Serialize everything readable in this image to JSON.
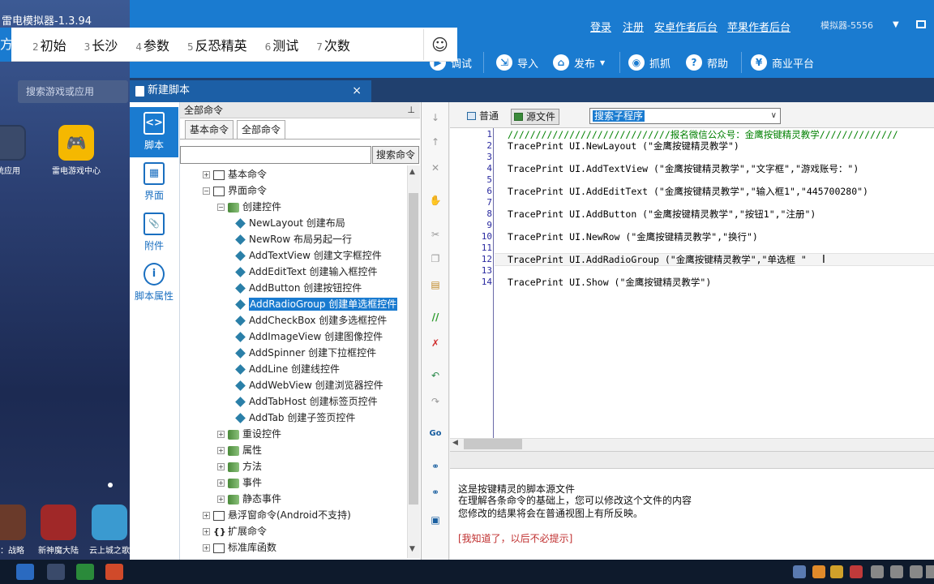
{
  "emulator": {
    "title": "雷电模拟器-1.3.94",
    "search_placeholder": "搜索游戏或应用",
    "apps": [
      {
        "label": "统应用",
        "icon": "system-apps-icon",
        "color": "#3a4a6a"
      },
      {
        "label": "雷电游戏中心",
        "icon": "game-center-icon",
        "color": "#f5b800"
      },
      {
        "label": "忠：战略",
        "icon": "game-icon",
        "color": "#6a3a2a"
      },
      {
        "label": "新神魔大陆",
        "icon": "game-icon",
        "color": "#a02828"
      },
      {
        "label": "云上城之歌",
        "icon": "game-icon",
        "color": "#3a9ad0"
      }
    ]
  },
  "overlay_tabs": {
    "first_partial": "方",
    "items": [
      {
        "num": "2",
        "label": "初始"
      },
      {
        "num": "3",
        "label": "长沙"
      },
      {
        "num": "4",
        "label": "参数"
      },
      {
        "num": "5",
        "label": "反恐精英"
      },
      {
        "num": "6",
        "label": "测试"
      },
      {
        "num": "7",
        "label": "次数"
      }
    ],
    "emoji": "☺"
  },
  "topbar": {
    "links": [
      "登录",
      "注册",
      "安卓作者后台",
      "苹果作者后台"
    ],
    "emulator_label": "模拟器-5556",
    "toolbar": [
      {
        "label": "调试",
        "icon": "debug-icon"
      },
      {
        "label": "导入",
        "icon": "import-icon"
      },
      {
        "label": "发布",
        "icon": "publish-icon"
      },
      {
        "label": "抓抓",
        "icon": "camera-icon"
      },
      {
        "label": "帮助",
        "icon": "help-icon"
      },
      {
        "label": "商业平台",
        "icon": "business-icon"
      }
    ]
  },
  "doc_tab": {
    "title": "新建脚本",
    "close": "×"
  },
  "sidebar": {
    "items": [
      {
        "label": "脚本",
        "glyph": "<>"
      },
      {
        "label": "界面",
        "glyph": "▦"
      },
      {
        "label": "附件",
        "glyph": "📎"
      },
      {
        "label": "脚本属性",
        "glyph": "i"
      }
    ]
  },
  "commands": {
    "header": "全部命令",
    "pin": "ᆞ",
    "tabs": [
      "基本命令",
      "全部命令"
    ],
    "search_button": "搜索命令",
    "tree": [
      {
        "label": "基本命令",
        "level": 0,
        "type": "group",
        "exp": "+"
      },
      {
        "label": "界面命令",
        "level": 0,
        "type": "group",
        "exp": "−"
      },
      {
        "label": "创建控件",
        "level": 1,
        "type": "folder",
        "exp": "−"
      },
      {
        "label": "NewLayout 创建布局",
        "level": 2,
        "type": "item"
      },
      {
        "label": "NewRow 布局另起一行",
        "level": 2,
        "type": "item"
      },
      {
        "label": "AddTextView 创建文字框控件",
        "level": 2,
        "type": "item"
      },
      {
        "label": "AddEditText 创建输入框控件",
        "level": 2,
        "type": "item"
      },
      {
        "label": "AddButton 创建按钮控件",
        "level": 2,
        "type": "item"
      },
      {
        "label": "AddRadioGroup 创建单选框控件",
        "level": 2,
        "type": "item",
        "selected": true
      },
      {
        "label": "AddCheckBox 创建多选框控件",
        "level": 2,
        "type": "item"
      },
      {
        "label": "AddImageView 创建图像控件",
        "level": 2,
        "type": "item"
      },
      {
        "label": "AddSpinner 创建下拉框控件",
        "level": 2,
        "type": "item"
      },
      {
        "label": "AddLine 创建线控件",
        "level": 2,
        "type": "item"
      },
      {
        "label": "AddWebView 创建浏览器控件",
        "level": 2,
        "type": "item"
      },
      {
        "label": "AddTabHost 创建标签页控件",
        "level": 2,
        "type": "item"
      },
      {
        "label": "AddTab 创建子签页控件",
        "level": 2,
        "type": "item"
      },
      {
        "label": "重设控件",
        "level": 1,
        "type": "folder",
        "exp": "+"
      },
      {
        "label": "属性",
        "level": 1,
        "type": "folder",
        "exp": "+"
      },
      {
        "label": "方法",
        "level": 1,
        "type": "folder",
        "exp": "+"
      },
      {
        "label": "事件",
        "level": 1,
        "type": "folder",
        "exp": "+"
      },
      {
        "label": "静态事件",
        "level": 1,
        "type": "folder",
        "exp": "+"
      },
      {
        "label": "悬浮窗命令(Android不支持)",
        "level": 0,
        "type": "group",
        "exp": "+"
      },
      {
        "label": "扩展命令",
        "level": 0,
        "type": "group",
        "exp": "+",
        "glyph": "{}"
      },
      {
        "label": "标准库函数",
        "level": 0,
        "type": "group",
        "exp": "+"
      }
    ]
  },
  "editor": {
    "view_normal": "普通",
    "view_source": "源文件",
    "sub_select": "搜索子程序",
    "lines": [
      {
        "n": "1",
        "text": "/////////////////////////////报名微信公众号：金鹰按键精灵教学//////////////",
        "comment": true
      },
      {
        "n": "2",
        "text": "TracePrint UI.NewLayout (\"金鹰按键精灵教学\")"
      },
      {
        "n": "3",
        "text": ""
      },
      {
        "n": "4",
        "text": "TracePrint UI.AddTextView (\"金鹰按键精灵教学\",\"文字框\",\"游戏账号：\")"
      },
      {
        "n": "5",
        "text": ""
      },
      {
        "n": "6",
        "text": "TracePrint UI.AddEditText (\"金鹰按键精灵教学\",\"输入框1\",\"445700280\")"
      },
      {
        "n": "7",
        "text": ""
      },
      {
        "n": "8",
        "text": "TracePrint UI.AddButton (\"金鹰按键精灵教学\",\"按钮1\",\"注册\")"
      },
      {
        "n": "9",
        "text": ""
      },
      {
        "n": "10",
        "text": "TracePrint UI.NewRow (\"金鹰按键精灵教学\",\"换行\")"
      },
      {
        "n": "11",
        "text": ""
      },
      {
        "n": "12",
        "text": "TracePrint UI.AddRadioGroup (\"金鹰按键精灵教学\",\"单选框 \"",
        "current": true
      },
      {
        "n": "13",
        "text": ""
      },
      {
        "n": "14",
        "text": "TracePrint UI.Show (\"金鹰按键精灵教学\")"
      }
    ],
    "cursor_glyph": "I"
  },
  "info": {
    "lines": [
      "这是按键精灵的脚本源文件",
      "在理解各条命令的基础上，您可以修改这个文件的内容",
      "您修改的结果将会在普通视图上有所反映。"
    ],
    "dismiss": "[我知道了，以后不必提示]"
  },
  "colors": {
    "accent": "#1a7bd0",
    "comment": "#008000",
    "dismiss": "#c03030"
  }
}
